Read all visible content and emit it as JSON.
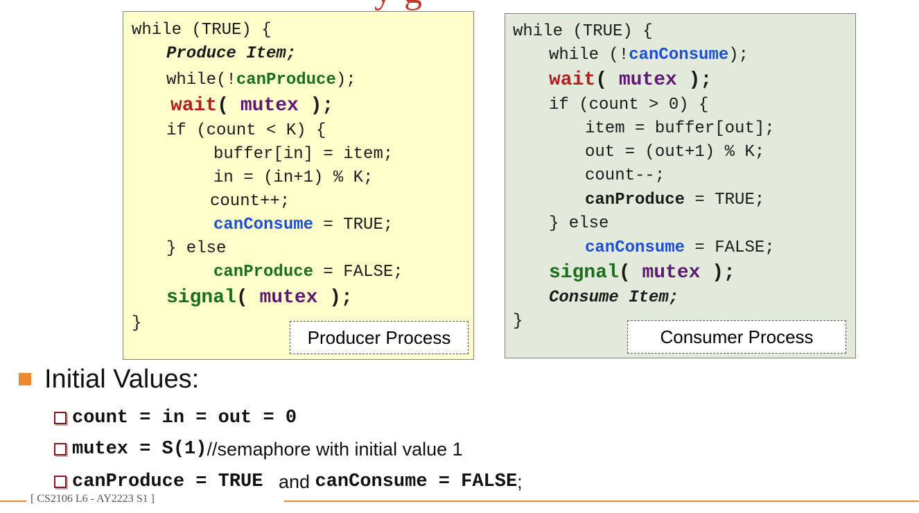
{
  "title_fragment": "y   g",
  "producer": {
    "lines": {
      "l1": "while (TRUE) {",
      "l2": "Produce Item;",
      "l3a": "while(!",
      "l3b": "canProduce",
      "l3c": ");",
      "l4a": "wait",
      "l4b": "( ",
      "l4c": "mutex",
      "l4d": " );",
      "l5": "if (count < K) {",
      "l6": "buffer[in] = item;",
      "l7": "in = (in+1) % K;",
      "l8": "count++;",
      "l9a": "canConsume",
      "l9b": " = TRUE;",
      "l10": "} else",
      "l11a": "canProduce",
      "l11b": " = FALSE;",
      "l12a": "signal",
      "l12b": "( ",
      "l12c": "mutex",
      "l12d": " );",
      "l13": "}"
    },
    "label": "Producer Process"
  },
  "consumer": {
    "lines": {
      "l1": "while (TRUE) {",
      "l2a": "while (!",
      "l2b": "canConsume",
      "l2c": ");",
      "l3a": "wait",
      "l3b": "( ",
      "l3c": "mutex",
      "l3d": " );",
      "l4": "if (count > 0) {",
      "l5": "item = buffer[out];",
      "l6": "out = (out+1) % K;",
      "l7": "count--;",
      "l8a": "canProduce",
      "l8b": " = TRUE;",
      "l9": "} else",
      "l10a": "canConsume",
      "l10b": " = FALSE;",
      "l11a": "signal",
      "l11b": "( ",
      "l11c": "mutex",
      "l11d": " );",
      "l12": "Consume Item;",
      "l13": "}"
    },
    "label": "Consumer Process"
  },
  "initial": {
    "heading": "Initial Values:",
    "items": [
      {
        "code": "count = in = out = 0",
        "text": ""
      },
      {
        "code": "mutex = S(1)",
        "text": " //semaphore with initial value 1"
      },
      {
        "code": "canProduce = TRUE",
        "text": "   and ",
        "code2": "canConsume = FALSE",
        "tail": ";"
      }
    ]
  },
  "footer": "[ CS2106 L6 - AY2223 S1 ]",
  "colors": {
    "producer_bg": "#ffffcc",
    "consumer_bg": "#e1eadb",
    "accent": "#ec8a32",
    "keyword_blue": "#1f4fd1",
    "keyword_green": "#1a6d1a",
    "keyword_red": "#b01f1f",
    "keyword_purple": "#5e1a73"
  }
}
